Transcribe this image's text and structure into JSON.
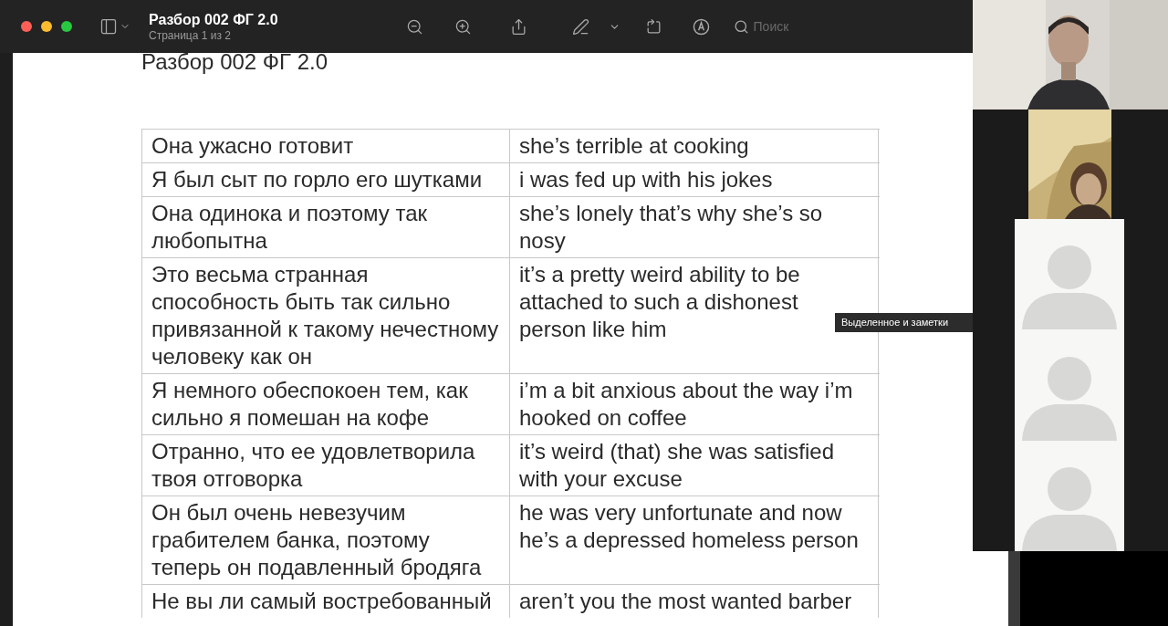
{
  "window": {
    "title": "Разбор 002 ФГ 2.0",
    "subtitle": "Страница 1 из 2",
    "search": {
      "placeholder": "Поиск"
    }
  },
  "document": {
    "title": "Разбор 002 ФГ 2.0",
    "rows": [
      {
        "russian": "Она ужасно готовит",
        "english": "she’s terrible at cooking"
      },
      {
        "russian": "Я был сыт по горло его шутками",
        "english": "i was fed up with his jokes"
      },
      {
        "russian": "Она одинока и поэтому так любопытна",
        "english": "she’s lonely that’s why she’s so nosy"
      },
      {
        "russian": "Это весьма странная способность быть так сильно привязанной к такому нечестному человеку как он",
        "english": "it’s a pretty weird ability to be attached to such a dishonest person like him"
      },
      {
        "russian": "Я немного обеспокоен тем, как сильно я помешан на кофе",
        "english": "i’m a bit anxious about the way i’m hooked on coffee"
      },
      {
        "russian": "Отранно, что ее удовлетворила твоя отговорка",
        "english": "it’s weird (that) she was satisfied with your excuse"
      },
      {
        "russian": "Он был очень невезучим грабителем банка, поэтому теперь он подавленный бродяга",
        "english": "he was very unfortunate and now he’s a depressed homeless person"
      },
      {
        "russian": "Не вы ли самый востребованный",
        "english": "aren’t you the most wanted barber"
      }
    ]
  },
  "tooltip": "Выделенное и заметки",
  "participants": [
    {
      "kind": "picture"
    },
    {
      "kind": "picture"
    },
    {
      "kind": "avatar"
    },
    {
      "kind": "avatar"
    },
    {
      "kind": "avatar"
    }
  ]
}
